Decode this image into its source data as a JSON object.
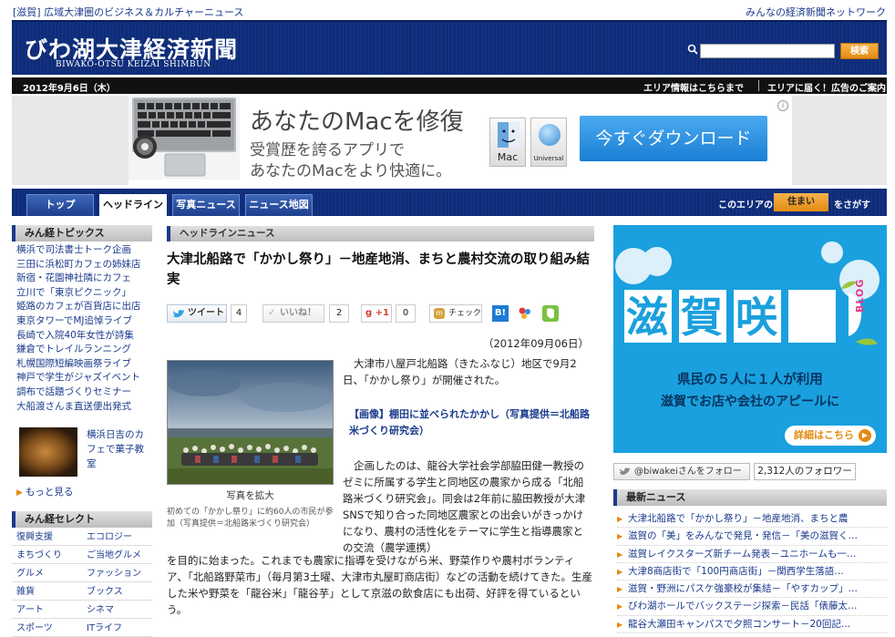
{
  "top": {
    "left": "[滋賀] 広域大津圏のビジネス＆カルチャーニュース",
    "right": "みんなの経済新聞ネットワーク"
  },
  "masthead": {
    "logo": "びわ湖大津経済新聞",
    "logo_sub": "BIWAKO-OTSU KEIZAI SHIMBUN",
    "search_btn": "検索"
  },
  "datebar": {
    "date": "2012年9月6日（木）",
    "area_info": "エリア情報はこちらまで",
    "area_ad": "エリアに届く！広告のご案内"
  },
  "ad": {
    "headline": "あなたのMacを修復",
    "line1": "受賞歴を誇るアプリで",
    "line2": "あなたのMacをより快適に。",
    "mac_label": "Mac",
    "universal_label": "Universal",
    "cta": "今すぐダウンロード",
    "info": "i"
  },
  "nav": {
    "tabs": [
      "トップ",
      "ヘッドライン",
      "写真ニュース",
      "ニュース地図"
    ],
    "active": 1,
    "area_prefix": "このエリアの",
    "area_btn": "住まい",
    "area_suffix": "をさがす"
  },
  "left": {
    "topics_title": "みん経トピックス",
    "topics": [
      "横浜で司法書士トーク企画",
      "三田に浜松町カフェの姉妹店",
      "新宿・花園神社隣にカフェ",
      "立川で「東京ピクニック」",
      "姫路のカフェが百貨店に出店",
      "東京タワーでMJ追悼ライブ",
      "長崎で入院40年女性が詩集",
      "鎌倉でトレイルランニング",
      "札幌国際短編映画祭ライブ",
      "神戸で学生がジャズイベント",
      "調布で話題づくりセミナー",
      "大船渡さんま直送便出発式"
    ],
    "feature_text": "横浜日吉のカフェで菓子教室",
    "more": "もっと見る",
    "select_title": "みん経セレクト",
    "select": [
      [
        "復興支援",
        "エコロジー"
      ],
      [
        "まちづくり",
        "ご当地グルメ"
      ],
      [
        "グルメ",
        "ファッション"
      ],
      [
        "雑貨",
        "ブックス"
      ],
      [
        "アート",
        "シネマ"
      ],
      [
        "スポーツ",
        "ITライフ"
      ]
    ]
  },
  "article": {
    "section": "ヘッドラインニュース",
    "title": "大津北船路で「かかし祭り」－地産地消、まちと農村交流の取り組み結実",
    "tweet": "ツイート",
    "tweet_count": "4",
    "like": "いいね！",
    "like_count": "2",
    "gplus": "+1",
    "gplus_count": "0",
    "check": "チェック",
    "date": "（2012年09月06日）",
    "photo_enlarge": "写真を拡大",
    "photo_caption": "初めての「かかし祭り」に約60人の市民が参加（写真提供＝北船路米づくり研究会）",
    "p1": "大津市八屋戸北船路（きたふなじ）地区で9月2日、「かかし祭り」が開催された。",
    "img_link": "【画像】棚田に並べられたかかし（写真提供＝北船路米づくり研究会）",
    "p2": "企画したのは、龍谷大学社会学部脇田健一教授のゼミに所属する学生と同地区の農家から成る「北船路米づくり研究会」。同会は2年前に脇田教授が大津SNSで知り合った同地区農家との出会いがきっかけになり、農村の活性化をテーマに学生と指導農家との交流（農学連携）",
    "p3": "を目的に始まった。これまでも農家に指導を受けながら米、野菜作りや農村ボランティア、「北船路野菜市」（毎月第3土曜、大津市丸屋町商店街）などの活動を続けてきた。生産した米や野菜を「龍谷米」「龍谷芋」として京滋の飲食店にも出荷、好評を得ているという。"
  },
  "right": {
    "banner_title": "滋賀咲く",
    "banner_blog": "BLOG",
    "banner_line1": "県民の５人に１人が利用",
    "banner_line2": "滋賀でお店や会社のアピールに",
    "banner_cta": "詳細はこちら",
    "follow": "@biwakeiさんをフォロー",
    "followers": "2,312人のフォロワー",
    "news_title": "最新ニュース",
    "news": [
      "大津北船路で「かかし祭り」－地産地消、まちと農",
      "滋賀の「美」をみんなで発見・発信－「美の滋賀く…",
      "滋賀レイクスターズ新チーム発表－ユニホームも一…",
      "大津8商店街で「100円商店街」－関西学生落語…",
      "滋賀・野洲にパスケ強豪校が集結－「やすカップ」…",
      "びわ湖ホールでバックステージ探索－民話「俵藤太…",
      "龍谷大瀬田キャンパスで夕照コンサート－20回記…"
    ]
  },
  "colors": {
    "navy": "#0f2c78",
    "orange": "#e38b12",
    "link": "#1a3a8c",
    "banner_blue": "#1aa0de"
  }
}
